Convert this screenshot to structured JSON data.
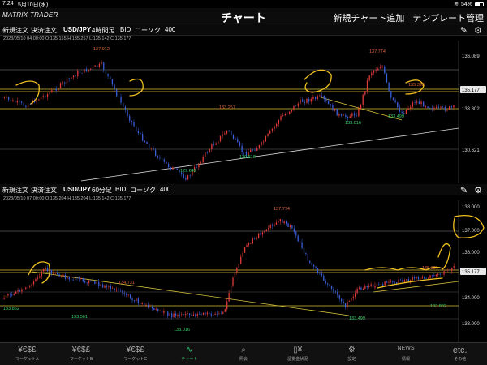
{
  "status_bar": {
    "time": "7:24",
    "date": "5月10日(水)",
    "battery": "54%"
  },
  "nav": {
    "logo": "MATRIX TRADER",
    "title": "チャート",
    "add_chart": "新規チャート追加",
    "template": "テンプレート管理"
  },
  "charts": [
    {
      "buttons": {
        "new_order": "新規注文",
        "close_order": "決済注文",
        "pair": "USD/JPY",
        "timeframe": "4時間足",
        "bid": "BID",
        "style": "ローソク",
        "count": "400"
      },
      "ohlc": "2023/05/10 04:00:00   O:135.155   H:135.257   L:135.142   C:135.177",
      "price_labels": [
        "136.089",
        "135.177",
        "133.802",
        "130.621"
      ],
      "labels_high": [
        "137.912",
        "133.257",
        "137.774",
        "135.393"
      ],
      "labels_low": [
        "133.016",
        "133.499",
        "130.618",
        "129.642"
      ]
    },
    {
      "buttons": {
        "new_order": "新規注文",
        "close_order": "決済注文",
        "pair": "USD/JPY",
        "timeframe": "60分足",
        "bid": "BID",
        "style": "ローソク",
        "count": "400"
      },
      "ohlc": "2023/05/10 07:00:00   O:135.204   H:135.204   L:135.142   C:135.177",
      "price_labels": [
        "138.000",
        "137.000",
        "136.000",
        "135.177",
        "134.000",
        "133.000"
      ],
      "labels_high": [
        "137.774",
        "134.731",
        "135.391"
      ],
      "labels_low": [
        "133.862",
        "133.561",
        "133.016",
        "133.499",
        "133.802"
      ]
    }
  ],
  "tabs": [
    {
      "label": "マーケットA",
      "icon": "currency-icon"
    },
    {
      "label": "マーケットB",
      "icon": "currency-icon"
    },
    {
      "label": "マーケットC",
      "icon": "currency-icon"
    },
    {
      "label": "チャート",
      "icon": "chart-icon"
    },
    {
      "label": "照会",
      "icon": "search-icon"
    },
    {
      "label": "証拠金状況",
      "icon": "margin-icon"
    },
    {
      "label": "設定",
      "icon": "gear-icon"
    },
    {
      "label": "情報",
      "icon": "news-icon"
    },
    {
      "label": "その他",
      "icon": "etc-icon"
    }
  ],
  "tab_glyphs": [
    "¥€$£",
    "¥€$£",
    "¥€$£",
    "∿",
    "⌕",
    "▯¥",
    "⚙",
    "NEWS",
    "etc."
  ],
  "colors": {
    "up": "#e23b3b",
    "down": "#3b5fd9",
    "support": "#d8c23a",
    "trend": "#d8c23a",
    "tab_active": "#2fd47a",
    "annotation": "#f0c020"
  }
}
